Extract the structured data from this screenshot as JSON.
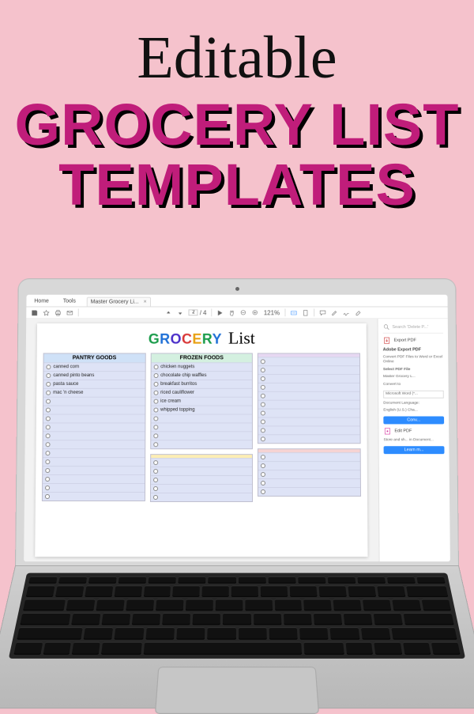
{
  "headline": {
    "top": "Editable",
    "line1": "GROCERY LIST",
    "line2": "TEMPLATES"
  },
  "acrobat": {
    "tabs": {
      "home": "Home",
      "tools": "Tools",
      "doc_name": "Master Grocery Li...",
      "close": "×"
    },
    "toolbar": {
      "page_current": "2",
      "page_sep": "/",
      "page_total": "4",
      "zoom": "121%"
    },
    "side": {
      "search_placeholder": "Search 'Delete P...'",
      "export_title": "Export PDF",
      "export_sub": "Adobe Export PDF",
      "export_desc": "Convert PDF Files to Word or Excel Online",
      "select_label": "Select PDF File",
      "selected_file": "Master Grocery L...",
      "convert_to": "Convert to",
      "convert_target": "Microsoft Word (*...",
      "lang_label": "Document Language:",
      "lang_value": "English (U.S.) Cha...",
      "convert_btn": "Conv...",
      "edit_pdf": "Edit PDF",
      "store_text": "Store and sh... in Document...",
      "learn_btn": "Learn m..."
    }
  },
  "doc": {
    "title_letters": [
      {
        "t": "G",
        "c": "#1a9c4a"
      },
      {
        "t": "R",
        "c": "#1e6fd6"
      },
      {
        "t": "O",
        "c": "#4b2fc9"
      },
      {
        "t": "C",
        "c": "#d93838"
      },
      {
        "t": "E",
        "c": "#e8a012"
      },
      {
        "t": "R",
        "c": "#1a9c4a"
      },
      {
        "t": "Y",
        "c": "#1e6fd6"
      }
    ],
    "title_script": "List",
    "columns": [
      {
        "header": "PANTRY GOODS",
        "header_bg": "#cfe1f7",
        "items": [
          "canned corn",
          "canned pinto beans",
          "pasta sauce",
          "mac 'n cheese",
          "",
          "",
          "",
          "",
          "",
          "",
          "",
          "",
          "",
          "",
          "",
          ""
        ]
      },
      {
        "header": "FROZEN FOODS",
        "header_bg": "#d4f0e0",
        "items": [
          "chicken nuggets",
          "chocolate chip waffles",
          "breakfast burritos",
          "riced cauliflower",
          "ice cream",
          "whipped topping",
          "",
          "",
          "",
          ""
        ],
        "second": {
          "header": "",
          "header_bg": "#fdeeb4",
          "items": [
            "",
            "",
            "",
            "",
            ""
          ]
        }
      },
      {
        "header": "",
        "header_bg": "#e7d8f2",
        "items": [
          "",
          "",
          "",
          "",
          "",
          "",
          "",
          "",
          "",
          ""
        ],
        "second": {
          "header": "",
          "header_bg": "#f6d3d3",
          "items": [
            "",
            "",
            "",
            "",
            ""
          ]
        }
      }
    ]
  }
}
